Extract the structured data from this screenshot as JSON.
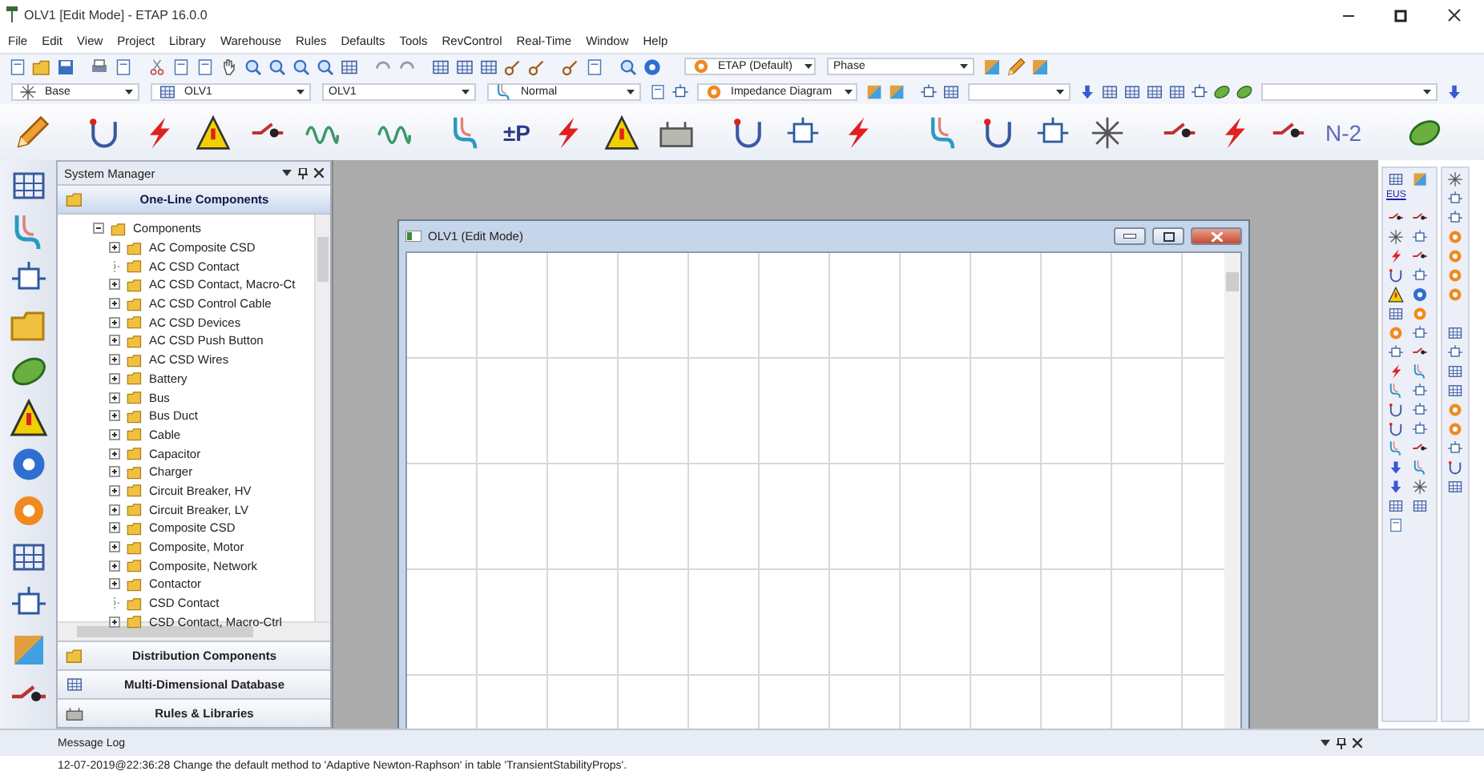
{
  "window": {
    "title": "OLV1 [Edit Mode] - ETAP 16.0.0"
  },
  "menu": [
    "File",
    "Edit",
    "View",
    "Project",
    "Library",
    "Warehouse",
    "Rules",
    "Defaults",
    "Tools",
    "RevControl",
    "Real-Time",
    "Window",
    "Help"
  ],
  "toolbar_1": {
    "combos": [
      {
        "value": "ETAP (Default)"
      },
      {
        "value": "Phase"
      }
    ]
  },
  "toolbar_2": {
    "combos": [
      {
        "value": "Base"
      },
      {
        "value": "OLV1"
      },
      {
        "value": "OLV1"
      },
      {
        "value": "Normal"
      },
      {
        "value": "Impedance Diagram"
      }
    ]
  },
  "toolbar_3": {
    "buttons": [
      {
        "label": "±P"
      },
      {
        "label": "N-2"
      }
    ]
  },
  "system_manager": {
    "title": "System Manager",
    "sections": [
      {
        "label": "One-Line Components",
        "selected": true
      },
      {
        "label": "Distribution Components",
        "selected": false
      },
      {
        "label": "Multi-Dimensional Database",
        "selected": false
      },
      {
        "label": "Rules & Libraries",
        "selected": false
      }
    ],
    "tree": [
      {
        "label": "Components",
        "expandable": true,
        "expanded": true,
        "children": [
          {
            "label": "AC Composite CSD",
            "expandable": true
          },
          {
            "label": "AC CSD Contact",
            "expandable": false
          },
          {
            "label": "AC CSD Contact, Macro-Ct",
            "expandable": true
          },
          {
            "label": "AC CSD Control Cable",
            "expandable": true
          },
          {
            "label": "AC CSD Devices",
            "expandable": true
          },
          {
            "label": "AC CSD Push Button",
            "expandable": true
          },
          {
            "label": "AC CSD Wires",
            "expandable": true
          },
          {
            "label": "Battery",
            "expandable": true
          },
          {
            "label": "Bus",
            "expandable": true
          },
          {
            "label": "Bus Duct",
            "expandable": true
          },
          {
            "label": "Cable",
            "expandable": true
          },
          {
            "label": "Capacitor",
            "expandable": true
          },
          {
            "label": "Charger",
            "expandable": true
          },
          {
            "label": "Circuit Breaker, HV",
            "expandable": true
          },
          {
            "label": "Circuit Breaker, LV",
            "expandable": true
          },
          {
            "label": "Composite CSD",
            "expandable": true
          },
          {
            "label": "Composite, Motor",
            "expandable": true
          },
          {
            "label": "Composite, Network",
            "expandable": true
          },
          {
            "label": "Contactor",
            "expandable": true
          },
          {
            "label": "CSD Contact",
            "expandable": false
          },
          {
            "label": "CSD Contact, Macro-Ctrl",
            "expandable": true
          }
        ]
      }
    ]
  },
  "child_window": {
    "title": "OLV1 (Edit Mode)"
  },
  "palette": {
    "label": "EUS"
  },
  "message_log": {
    "title": "Message Log",
    "messages": [
      "12-07-2019@22:36:28 Change the default method to 'Adaptive Newton-Raphson' in table 'TransientStabilityProps'."
    ]
  }
}
